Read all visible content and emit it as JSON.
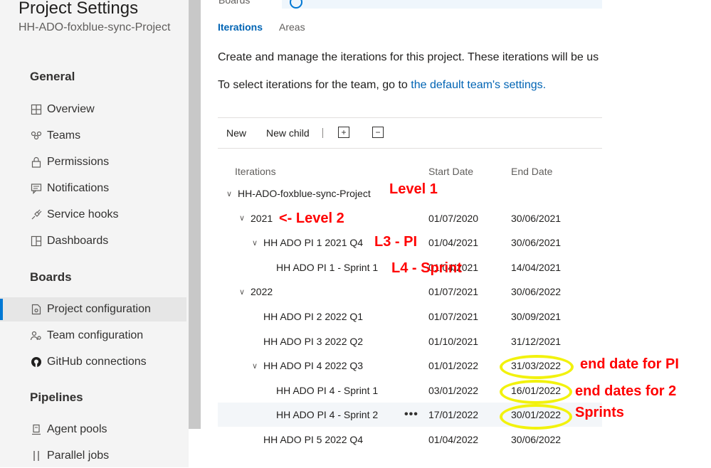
{
  "sidebar": {
    "title": "Project Settings",
    "subtitle": "HH-ADO-foxblue-sync-Project",
    "sections": [
      {
        "heading": "General",
        "items": [
          {
            "label": "Overview",
            "icon": "overview-icon"
          },
          {
            "label": "Teams",
            "icon": "teams-icon"
          },
          {
            "label": "Permissions",
            "icon": "lock-icon"
          },
          {
            "label": "Notifications",
            "icon": "notifications-icon"
          },
          {
            "label": "Service hooks",
            "icon": "plug-icon"
          },
          {
            "label": "Dashboards",
            "icon": "dashboards-icon"
          }
        ]
      },
      {
        "heading": "Boards",
        "items": [
          {
            "label": "Project configuration",
            "icon": "project-configuration-icon",
            "selected": true
          },
          {
            "label": "Team configuration",
            "icon": "team-configuration-icon"
          },
          {
            "label": "GitHub connections",
            "icon": "github-icon"
          }
        ]
      },
      {
        "heading": "Pipelines",
        "items": [
          {
            "label": "Agent pools",
            "icon": "agent-pools-icon"
          },
          {
            "label": "Parallel jobs",
            "icon": "parallel-jobs-icon"
          }
        ]
      }
    ]
  },
  "main": {
    "boards_fragment": "Boards",
    "tabs": [
      {
        "label": "Iterations",
        "active": true
      },
      {
        "label": "Areas",
        "active": false
      }
    ],
    "description_1": "Create and manage the iterations for this project. These iterations will be us",
    "description_2_prefix": "To select iterations for the team, go to ",
    "description_2_link": "the default team's settings.",
    "toolbar": {
      "new_label": "New",
      "new_child_label": "New child",
      "expand_symbol": "+",
      "collapse_symbol": "−"
    },
    "columns": {
      "iterations": "Iterations",
      "start_date": "Start Date",
      "end_date": "End Date"
    },
    "rows": [
      {
        "name": "HH-ADO-foxblue-sync-Project",
        "start": "",
        "end": "",
        "level": 0,
        "expanded": true
      },
      {
        "name": "2021",
        "start": "01/07/2020",
        "end": "30/06/2021",
        "level": 1,
        "expanded": true
      },
      {
        "name": "HH ADO PI 1 2021 Q4",
        "start": "01/04/2021",
        "end": "30/06/2021",
        "level": 2,
        "expanded": true
      },
      {
        "name": "HH ADO PI 1 - Sprint 1",
        "start": "01/04/2021",
        "end": "14/04/2021",
        "level": 3
      },
      {
        "name": "2022",
        "start": "01/07/2021",
        "end": "30/06/2022",
        "level": 1,
        "expanded": true
      },
      {
        "name": "HH ADO PI 2 2022 Q1",
        "start": "01/07/2021",
        "end": "30/09/2021",
        "level": 2
      },
      {
        "name": "HH ADO PI 3 2022 Q2",
        "start": "01/10/2021",
        "end": "31/12/2021",
        "level": 2
      },
      {
        "name": "HH ADO PI 4 2022 Q3",
        "start": "01/01/2022",
        "end": "31/03/2022",
        "level": 2,
        "expanded": true
      },
      {
        "name": "HH ADO PI 4 - Sprint 1",
        "start": "03/01/2022",
        "end": "16/01/2022",
        "level": 3
      },
      {
        "name": "HH ADO PI 4 - Sprint 2",
        "start": "17/01/2022",
        "end": "30/01/2022",
        "level": 3,
        "hover": true
      },
      {
        "name": "HH ADO PI 5 2022 Q4",
        "start": "01/04/2022",
        "end": "30/06/2022",
        "level": 2
      }
    ],
    "more_actions_symbol": "•••"
  },
  "annotations": {
    "level1": "Level 1",
    "level2": "<- Level 2",
    "l3": "L3  - PI",
    "l4": "L4 - Sprint",
    "end_date_pi": "end date for PI",
    "end_dates_sprints_1": "end dates for 2",
    "end_dates_sprints_2": "Sprints",
    "color": "#ff0000",
    "highlight_color": "#f2f20d"
  }
}
